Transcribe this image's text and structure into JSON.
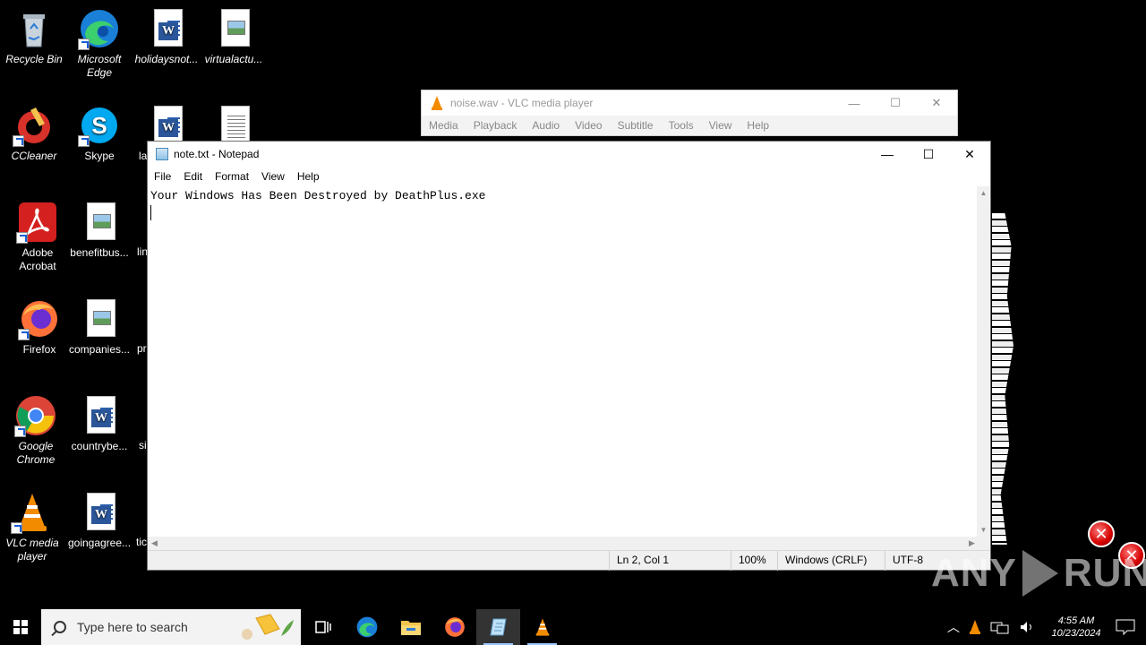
{
  "desktop_icons": [
    {
      "label": "Recycle Bin",
      "icon": "recycle-bin-icon"
    },
    {
      "label": "Microsoft Edge",
      "icon": "edge-icon"
    },
    {
      "label": "holidaysnot...",
      "icon": "word-doc-icon"
    },
    {
      "label": "virtualactu...",
      "icon": "image-file-icon"
    },
    {
      "label": "CCleaner",
      "icon": "ccleaner-icon"
    },
    {
      "label": "Skype",
      "icon": "skype-icon"
    },
    {
      "label": "la",
      "icon": "word-doc-icon"
    },
    {
      "label": "",
      "icon": "text-file-icon"
    },
    {
      "label": "Adobe Acrobat",
      "icon": "acrobat-icon"
    },
    {
      "label": "benefitbus...",
      "icon": "image-file-icon"
    },
    {
      "label": "lin",
      "icon": "file-icon"
    },
    {
      "label": "Firefox",
      "icon": "firefox-icon"
    },
    {
      "label": "companies...",
      "icon": "image-file-icon"
    },
    {
      "label": "pr",
      "icon": "file-icon"
    },
    {
      "label": "Google Chrome",
      "icon": "chrome-icon"
    },
    {
      "label": "countrybe...",
      "icon": "word-doc-icon"
    },
    {
      "label": "si",
      "icon": "file-icon"
    },
    {
      "label": "VLC media player",
      "icon": "vlc-icon"
    },
    {
      "label": "goingagree...",
      "icon": "word-doc-icon"
    },
    {
      "label": "tic",
      "icon": "file-icon"
    }
  ],
  "vlc": {
    "title": "noise.wav - VLC media player",
    "menu": [
      "Media",
      "Playback",
      "Audio",
      "Video",
      "Subtitle",
      "Tools",
      "View",
      "Help"
    ]
  },
  "notepad": {
    "title": "note.txt - Notepad",
    "menu": [
      "File",
      "Edit",
      "Format",
      "View",
      "Help"
    ],
    "content_line1": "Your Windows Has Been Destroyed by DeathPlus.exe",
    "status": {
      "position": "Ln 2, Col 1",
      "zoom": "100%",
      "line_ending": "Windows (CRLF)",
      "encoding": "UTF-8"
    }
  },
  "taskbar": {
    "search_placeholder": "Type here to search",
    "pinned": [
      "task-view-icon",
      "edge-icon",
      "file-explorer-icon",
      "firefox-icon",
      "notepad-icon",
      "vlc-icon"
    ],
    "clock_time": "4:55 AM",
    "clock_date": "10/23/2024"
  },
  "watermark": {
    "left": "ANY",
    "right": "RUN"
  }
}
